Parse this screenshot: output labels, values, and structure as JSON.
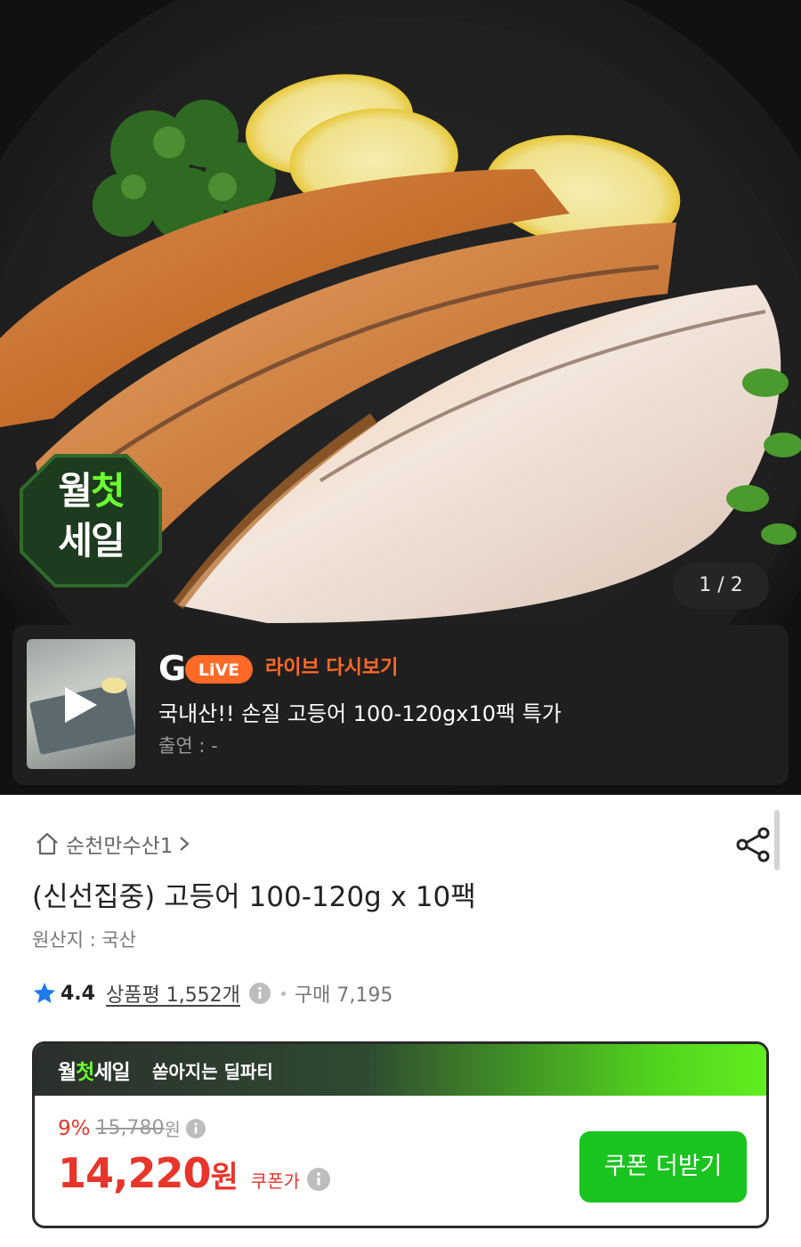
{
  "hero": {
    "sale_badge": {
      "line1_a": "월",
      "line1_b": "첫",
      "line2": "세일"
    },
    "pager": "1 / 2"
  },
  "live": {
    "logo_g": "G",
    "logo_live": "LiVE",
    "replay_label": "라이브 다시보기",
    "title": "국내산!! 손질 고등어 100-120gx10팩 특가",
    "cast": "출연 : -"
  },
  "product": {
    "store_name": "순천만수산1",
    "title": "(신선집중) 고등어 100-120g x 10팩",
    "origin": "원산지 : 국산",
    "rating": "4.4",
    "review_label": "상품평 1,552개",
    "buy_count": "구매 7,195"
  },
  "deal": {
    "logo_a": "월",
    "logo_b": "첫",
    "logo_c": "세일",
    "tagline": "쏟아지는 딜파티",
    "discount_rate": "9%",
    "original_price": "15,780",
    "original_unit": "원",
    "price": "14,220",
    "price_unit": "원",
    "coupon_price_label": "쿠폰가",
    "coupon_button": "쿠폰 더받기"
  },
  "colors": {
    "accent_red": "#e8352b",
    "accent_green": "#19c41f",
    "live_orange": "#ff6a26"
  }
}
